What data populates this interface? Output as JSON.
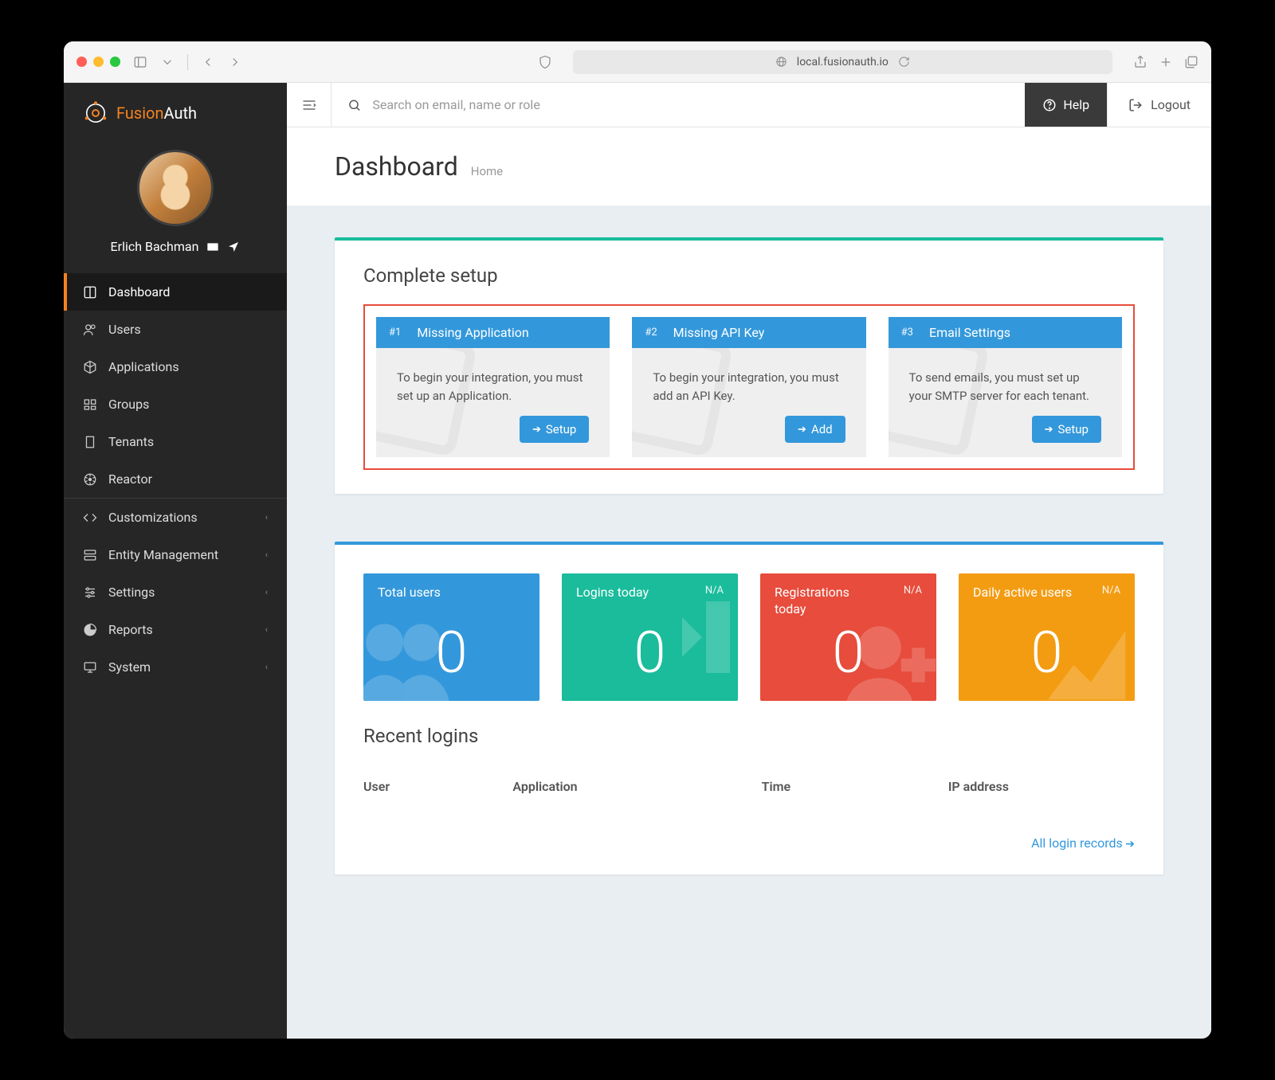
{
  "browser": {
    "url": "local.fusionauth.io"
  },
  "logo": {
    "brand_a": "Fusion",
    "brand_b": "Auth"
  },
  "profile": {
    "name": "Erlich Bachman"
  },
  "nav": {
    "dashboard": "Dashboard",
    "users": "Users",
    "applications": "Applications",
    "groups": "Groups",
    "tenants": "Tenants",
    "reactor": "Reactor",
    "customizations": "Customizations",
    "entity_management": "Entity Management",
    "settings": "Settings",
    "reports": "Reports",
    "system": "System"
  },
  "topbar": {
    "search_placeholder": "Search on email, name or role",
    "help": "Help",
    "logout": "Logout"
  },
  "page": {
    "title": "Dashboard",
    "crumb": "Home"
  },
  "setup": {
    "heading": "Complete setup",
    "cards": [
      {
        "num": "#1",
        "title": "Missing Application",
        "desc": "To begin your integration, you must set up an Application.",
        "btn": "Setup"
      },
      {
        "num": "#2",
        "title": "Missing API Key",
        "desc": "To begin your integration, you must add an API Key.",
        "btn": "Add"
      },
      {
        "num": "#3",
        "title": "Email Settings",
        "desc": "To send emails, you must set up your SMTP server for each tenant.",
        "btn": "Setup"
      }
    ]
  },
  "stats": [
    {
      "label": "Total users",
      "na": "",
      "value": "0"
    },
    {
      "label": "Logins today",
      "na": "N/A",
      "value": "0"
    },
    {
      "label": "Registrations today",
      "na": "N/A",
      "value": "0"
    },
    {
      "label": "Daily active users",
      "na": "N/A",
      "value": "0"
    }
  ],
  "recent": {
    "heading": "Recent logins",
    "cols": {
      "user": "User",
      "app": "Application",
      "time": "Time",
      "ip": "IP address"
    },
    "link": "All login records"
  }
}
